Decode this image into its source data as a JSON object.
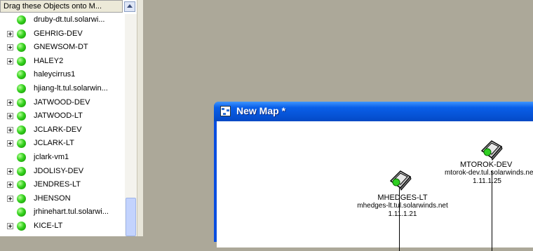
{
  "panel": {
    "header": "Drag these Objects onto M...",
    "items": [
      {
        "label": "druby-dt.tul.solarwi...",
        "expandable": false
      },
      {
        "label": "GEHRIG-DEV",
        "expandable": true
      },
      {
        "label": "GNEWSOM-DT",
        "expandable": true
      },
      {
        "label": "HALEY2",
        "expandable": true
      },
      {
        "label": "haleycirrus1",
        "expandable": false
      },
      {
        "label": "hjiang-lt.tul.solarwin...",
        "expandable": false
      },
      {
        "label": "JATWOOD-DEV",
        "expandable": true
      },
      {
        "label": "JATWOOD-LT",
        "expandable": true
      },
      {
        "label": "JCLARK-DEV",
        "expandable": true
      },
      {
        "label": "JCLARK-LT",
        "expandable": true
      },
      {
        "label": "jclark-vm1",
        "expandable": false
      },
      {
        "label": "JDOLISY-DEV",
        "expandable": true
      },
      {
        "label": "JENDRES-LT",
        "expandable": true
      },
      {
        "label": "JHENSON",
        "expandable": true
      },
      {
        "label": "jrhinehart.tul.solarwi...",
        "expandable": false
      },
      {
        "label": "KICE-LT",
        "expandable": true
      }
    ],
    "scroll_fraction": 0.85
  },
  "map_window": {
    "title": "New Map *",
    "nodes": [
      {
        "name": "MHEDGES-LT",
        "host": "mhedges-lt.tul.solarwinds.net",
        "ip": "1.11.1.21"
      },
      {
        "name": "MTOROK-DEV",
        "host": "mtorok-dev.tul.solarwinds.ne",
        "ip": "1.11.1.25"
      }
    ]
  },
  "colors": {
    "status_up": "#35d21e",
    "title_bar": "#0653d6",
    "workspace": "#aca899"
  }
}
